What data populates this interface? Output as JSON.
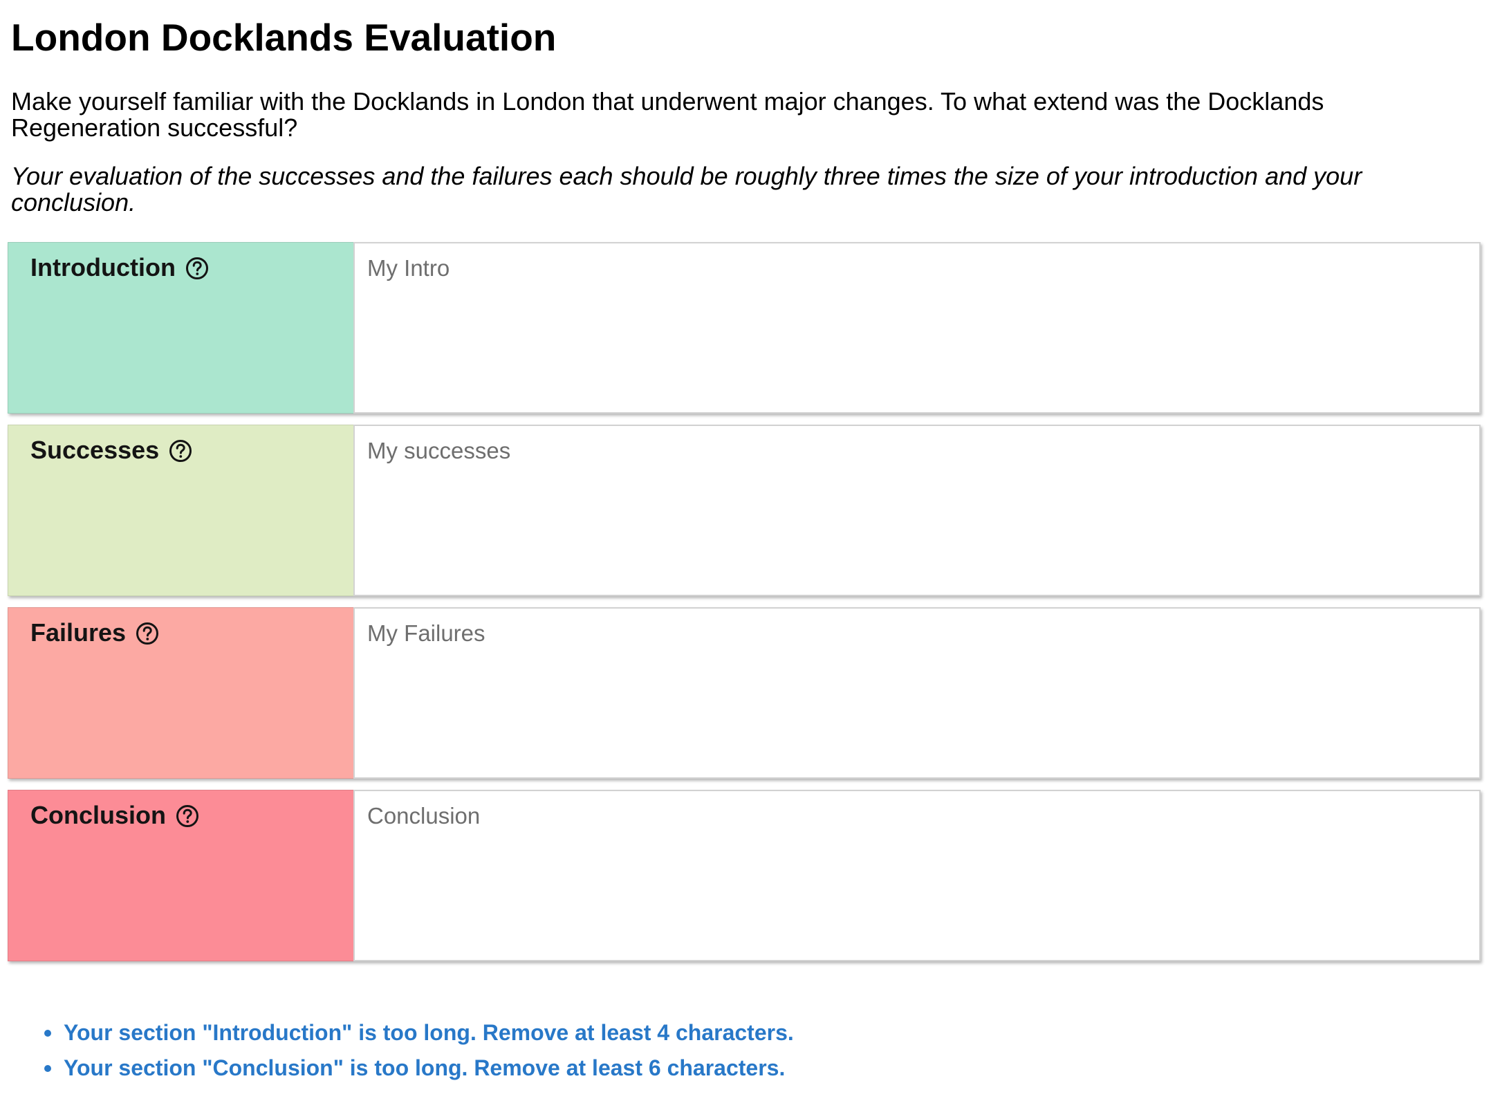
{
  "page": {
    "title": "London Docklands Evaluation",
    "instructions": "Make yourself familiar with the Docklands in London that underwent major changes. To what extend was the Docklands Regeneration successful?",
    "hint": "Your evaluation of the successes and the failures each should be roughly three times the size of your introduction and your conclusion."
  },
  "sections": [
    {
      "label": "Introduction",
      "placeholder": "My Intro",
      "color": "#abe6cf",
      "icon": "help-circle-icon"
    },
    {
      "label": "Successes",
      "placeholder": "My successes",
      "color": "#dfecc4",
      "icon": "help-circle-icon"
    },
    {
      "label": "Failures",
      "placeholder": "My Failures",
      "color": "#fca9a3",
      "icon": "help-circle-icon"
    },
    {
      "label": "Conclusion",
      "placeholder": "Conclusion",
      "color": "#fc8c96",
      "icon": "help-circle-icon"
    }
  ],
  "messages": {
    "color": "#2878c8",
    "items": [
      "Your section \"Introduction\" is too long. Remove at least 4 characters.",
      "Your section \"Conclusion\" is too long. Remove at least 6 characters."
    ]
  }
}
